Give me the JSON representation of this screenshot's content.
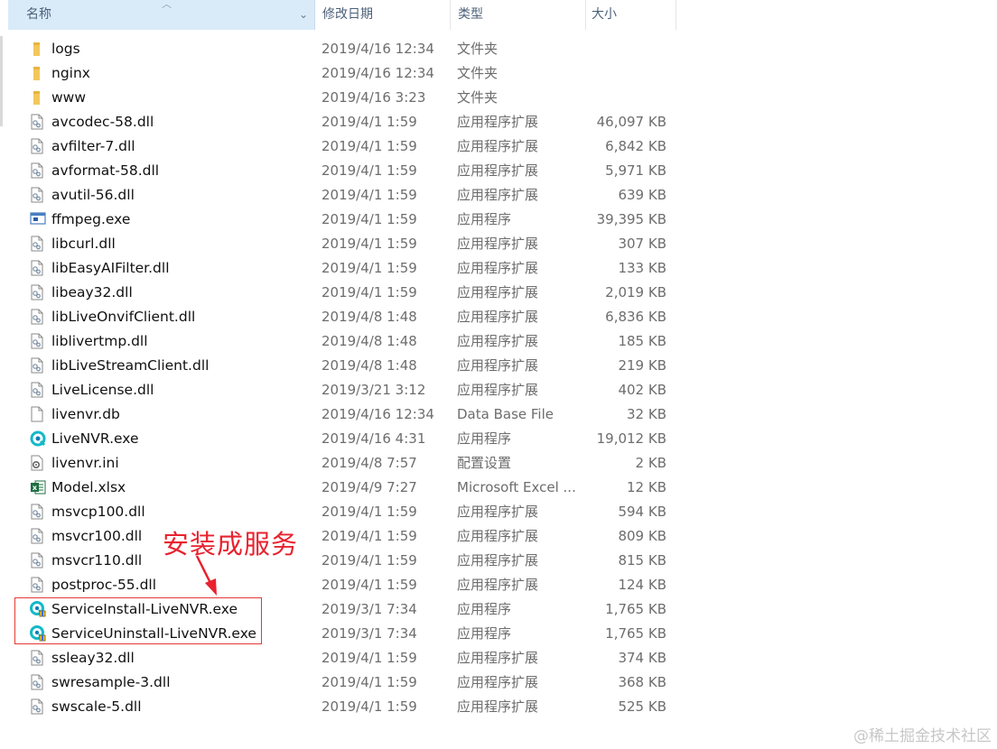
{
  "header": {
    "name": "名称",
    "date": "修改日期",
    "type": "类型",
    "size": "大小"
  },
  "files": [
    {
      "name": "logs",
      "date": "2019/4/16 12:34",
      "type": "文件夹",
      "size": "",
      "icon": "folder-icon"
    },
    {
      "name": "nginx",
      "date": "2019/4/16 12:34",
      "type": "文件夹",
      "size": "",
      "icon": "folder-icon"
    },
    {
      "name": "www",
      "date": "2019/4/16 3:23",
      "type": "文件夹",
      "size": "",
      "icon": "folder-icon"
    },
    {
      "name": "avcodec-58.dll",
      "date": "2019/4/1 1:59",
      "type": "应用程序扩展",
      "size": "46,097 KB",
      "icon": "dll-icon"
    },
    {
      "name": "avfilter-7.dll",
      "date": "2019/4/1 1:59",
      "type": "应用程序扩展",
      "size": "6,842 KB",
      "icon": "dll-icon"
    },
    {
      "name": "avformat-58.dll",
      "date": "2019/4/1 1:59",
      "type": "应用程序扩展",
      "size": "5,971 KB",
      "icon": "dll-icon"
    },
    {
      "name": "avutil-56.dll",
      "date": "2019/4/1 1:59",
      "type": "应用程序扩展",
      "size": "639 KB",
      "icon": "dll-icon"
    },
    {
      "name": "ffmpeg.exe",
      "date": "2019/4/1 1:59",
      "type": "应用程序",
      "size": "39,395 KB",
      "icon": "exe-icon"
    },
    {
      "name": "libcurl.dll",
      "date": "2019/4/1 1:59",
      "type": "应用程序扩展",
      "size": "307 KB",
      "icon": "dll-icon"
    },
    {
      "name": "libEasyAIFilter.dll",
      "date": "2019/4/1 1:59",
      "type": "应用程序扩展",
      "size": "133 KB",
      "icon": "dll-icon"
    },
    {
      "name": "libeay32.dll",
      "date": "2019/4/1 1:59",
      "type": "应用程序扩展",
      "size": "2,019 KB",
      "icon": "dll-icon"
    },
    {
      "name": "libLiveOnvifClient.dll",
      "date": "2019/4/8 1:48",
      "type": "应用程序扩展",
      "size": "6,836 KB",
      "icon": "dll-icon"
    },
    {
      "name": "liblivertmp.dll",
      "date": "2019/4/8 1:48",
      "type": "应用程序扩展",
      "size": "185 KB",
      "icon": "dll-icon"
    },
    {
      "name": "libLiveStreamClient.dll",
      "date": "2019/4/8 1:48",
      "type": "应用程序扩展",
      "size": "219 KB",
      "icon": "dll-icon"
    },
    {
      "name": "LiveLicense.dll",
      "date": "2019/3/21 3:12",
      "type": "应用程序扩展",
      "size": "402 KB",
      "icon": "dll-icon"
    },
    {
      "name": "livenvr.db",
      "date": "2019/4/16 12:34",
      "type": "Data Base File",
      "size": "32 KB",
      "icon": "file-icon"
    },
    {
      "name": "LiveNVR.exe",
      "date": "2019/4/16 4:31",
      "type": "应用程序",
      "size": "19,012 KB",
      "icon": "livenvr-icon"
    },
    {
      "name": "livenvr.ini",
      "date": "2019/4/8 7:57",
      "type": "配置设置",
      "size": "2 KB",
      "icon": "ini-icon"
    },
    {
      "name": "Model.xlsx",
      "date": "2019/4/9 7:27",
      "type": "Microsoft Excel ...",
      "size": "12 KB",
      "icon": "excel-icon"
    },
    {
      "name": "msvcp100.dll",
      "date": "2019/4/1 1:59",
      "type": "应用程序扩展",
      "size": "594 KB",
      "icon": "dll-icon"
    },
    {
      "name": "msvcr100.dll",
      "date": "2019/4/1 1:59",
      "type": "应用程序扩展",
      "size": "809 KB",
      "icon": "dll-icon"
    },
    {
      "name": "msvcr110.dll",
      "date": "2019/4/1 1:59",
      "type": "应用程序扩展",
      "size": "815 KB",
      "icon": "dll-icon"
    },
    {
      "name": "postproc-55.dll",
      "date": "2019/4/1 1:59",
      "type": "应用程序扩展",
      "size": "124 KB",
      "icon": "dll-icon"
    },
    {
      "name": "ServiceInstall-LiveNVR.exe",
      "date": "2019/3/1 7:34",
      "type": "应用程序",
      "size": "1,765 KB",
      "icon": "service-icon"
    },
    {
      "name": "ServiceUninstall-LiveNVR.exe",
      "date": "2019/3/1 7:34",
      "type": "应用程序",
      "size": "1,765 KB",
      "icon": "service-icon"
    },
    {
      "name": "ssleay32.dll",
      "date": "2019/4/1 1:59",
      "type": "应用程序扩展",
      "size": "374 KB",
      "icon": "dll-icon"
    },
    {
      "name": "swresample-3.dll",
      "date": "2019/4/1 1:59",
      "type": "应用程序扩展",
      "size": "368 KB",
      "icon": "dll-icon"
    },
    {
      "name": "swscale-5.dll",
      "date": "2019/4/1 1:59",
      "type": "应用程序扩展",
      "size": "525 KB",
      "icon": "dll-icon"
    }
  ],
  "annotation": {
    "label": "安装成服务",
    "color": "#e8222e"
  },
  "watermark": "@稀土掘金技术社区"
}
